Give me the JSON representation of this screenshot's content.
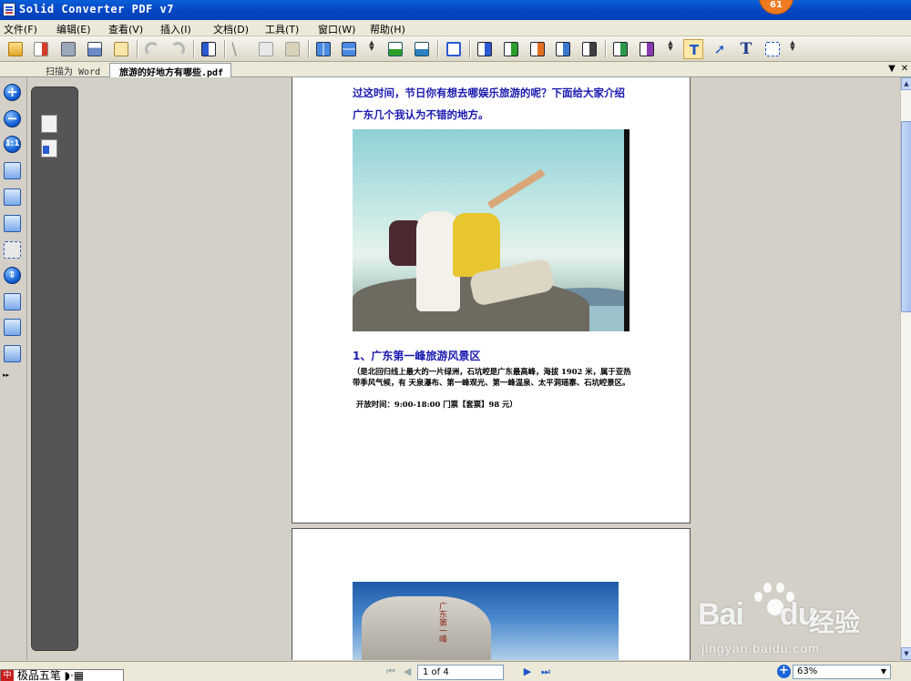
{
  "window": {
    "title": "Solid Converter PDF v7",
    "notification_count": "61"
  },
  "menu": [
    {
      "label": "文件(F)"
    },
    {
      "label": "编辑(E)"
    },
    {
      "label": "查看(V)"
    },
    {
      "label": "插入(I)"
    },
    {
      "label": "文档(D)"
    },
    {
      "label": "工具(T)"
    },
    {
      "label": "窗口(W)"
    },
    {
      "label": "帮助(H)"
    }
  ],
  "toolbar": {
    "icons": [
      "open-folder-icon",
      "convert-icon",
      "save-icon",
      "print-icon",
      "email-icon",
      "undo-icon",
      "redo-icon",
      "scan-icon",
      "cut-icon",
      "copy-icon",
      "paste-icon",
      "two-page-icon",
      "continuous-icon",
      "rotate-left-icon",
      "rotate-right-icon",
      "checkbox-icon",
      "export-word-icon",
      "export-excel-icon",
      "export-ppt-icon",
      "export-html-icon",
      "export-text-icon",
      "export-pdfa-icon",
      "export-image-icon",
      "select-text-icon",
      "pointer-icon",
      "typewriter-icon",
      "select-area-icon"
    ],
    "colors": {
      "primary": "#1a64d8",
      "accent_green": "#2aa02a",
      "accent_red": "#d63a2a"
    }
  },
  "tabs": [
    {
      "label": "扫描为 Word",
      "active": false
    },
    {
      "label": "旅游的好地方有哪些.pdf",
      "active": true
    }
  ],
  "document": {
    "intro_line1": "过这时间，节日你有想去哪娱乐旅游的呢？下面给大家介绍",
    "intro_line2": "广东几个我认为不错的地方。",
    "section_title": "1、广东第一峰旅游风景区",
    "description": "（是北回归线上最大的一片绿洲，石坑崆是广东最高峰，海拔 1902 米，属于亚热带季风气候，有 天泉瀑布、第一峰观光、第一峰温泉、太平洞瑶寨、石坑崆景区。",
    "hours": "开放时间：9:00-18:00  门票【套票】98 元）",
    "stone_text": "广东第一峰"
  },
  "statusbar": {
    "ime_text": "极品五笔",
    "page_indicator": "1 of 4",
    "zoom": "63%"
  },
  "watermark": {
    "brand": "Bai",
    "brand2": "du",
    "cn": "经验",
    "url": "jingyan.baidu.com"
  }
}
